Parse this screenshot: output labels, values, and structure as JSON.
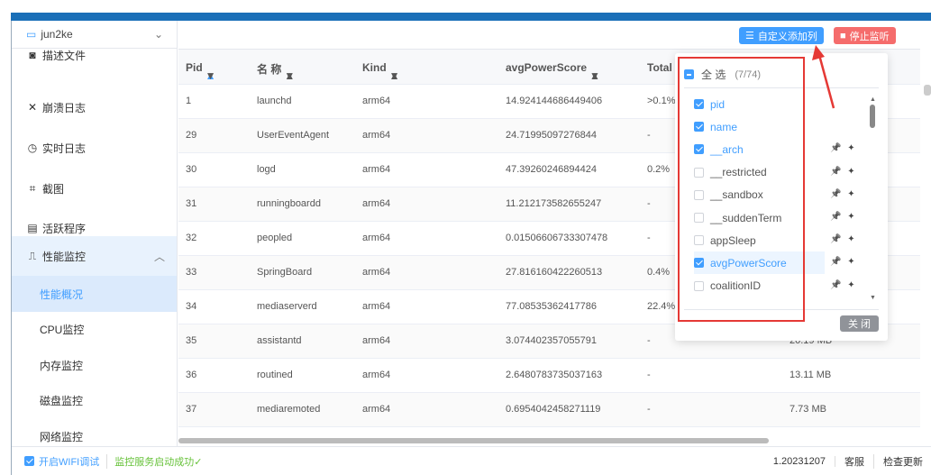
{
  "device": {
    "name": "jun2ke"
  },
  "sidebar": {
    "items": [
      {
        "label": "描述文件",
        "icon": "profile-file-icon"
      },
      {
        "label": "崩溃日志",
        "icon": "crash-log-icon"
      },
      {
        "label": "实时日志",
        "icon": "realtime-log-icon"
      },
      {
        "label": "截图",
        "icon": "screenshot-icon"
      },
      {
        "label": "活跃程序",
        "icon": "active-apps-icon"
      },
      {
        "label": "性能监控",
        "icon": "performance-icon"
      }
    ],
    "subitems": [
      "性能概况",
      "CPU监控",
      "内存监控",
      "磁盘监控",
      "网络监控"
    ],
    "active": "性能概况"
  },
  "toolbar": {
    "custom_columns": "自定义添加列",
    "stop": "停止监听"
  },
  "table": {
    "headers": [
      "Pid",
      "名 称",
      "Kind",
      "avgPowerScore",
      "Total I"
    ],
    "rows": [
      [
        "1",
        "launchd",
        "arm64",
        "14.924144686449406",
        ">0.1%",
        ""
      ],
      [
        "29",
        "UserEventAgent",
        "arm64",
        "24.71995097276844",
        "-",
        ""
      ],
      [
        "30",
        "logd",
        "arm64",
        "47.39260246894424",
        "0.2%",
        ""
      ],
      [
        "31",
        "runningboardd",
        "arm64",
        "11.212173582655247",
        "-",
        ""
      ],
      [
        "32",
        "peopled",
        "arm64",
        "0.01506606733307478",
        "-",
        ""
      ],
      [
        "33",
        "SpringBoard",
        "arm64",
        "27.816160422260513",
        "0.4%",
        ""
      ],
      [
        "34",
        "mediaserverd",
        "arm64",
        "77.08535362417786",
        "22.4%",
        ""
      ],
      [
        "35",
        "assistantd",
        "arm64",
        "3.074402357055791",
        "-",
        "20.19 MB"
      ],
      [
        "36",
        "routined",
        "arm64",
        "2.6480783735037163",
        "-",
        "13.11 MB"
      ],
      [
        "37",
        "mediaremoted",
        "arm64",
        "0.6954042458271119",
        "-",
        "7.73 MB"
      ]
    ]
  },
  "column_picker": {
    "select_all": "全 选",
    "count": "(7/74)",
    "close": "关 闭",
    "items": [
      {
        "label": "pid",
        "checked": true,
        "pins": false
      },
      {
        "label": "name",
        "checked": true,
        "pins": false
      },
      {
        "label": "__arch",
        "checked": true,
        "pins": true
      },
      {
        "label": "__restricted",
        "checked": false,
        "pins": true
      },
      {
        "label": "__sandbox",
        "checked": false,
        "pins": true
      },
      {
        "label": "__suddenTerm",
        "checked": false,
        "pins": true
      },
      {
        "label": "appSleep",
        "checked": false,
        "pins": true
      },
      {
        "label": "avgPowerScore",
        "checked": true,
        "pins": true
      },
      {
        "label": "coalitionID",
        "checked": false,
        "pins": true
      }
    ]
  },
  "footer": {
    "wifi_debug": "开启WIFI调试",
    "status": "监控服务启动成功✓",
    "version": "1.20231207",
    "support": "客服",
    "update": "检查更新"
  },
  "colors": {
    "accent": "#409eff",
    "topbar": "#1a6fb8",
    "stop": "#f56c6c",
    "annotation": "#e53935",
    "success": "#67c23a"
  }
}
